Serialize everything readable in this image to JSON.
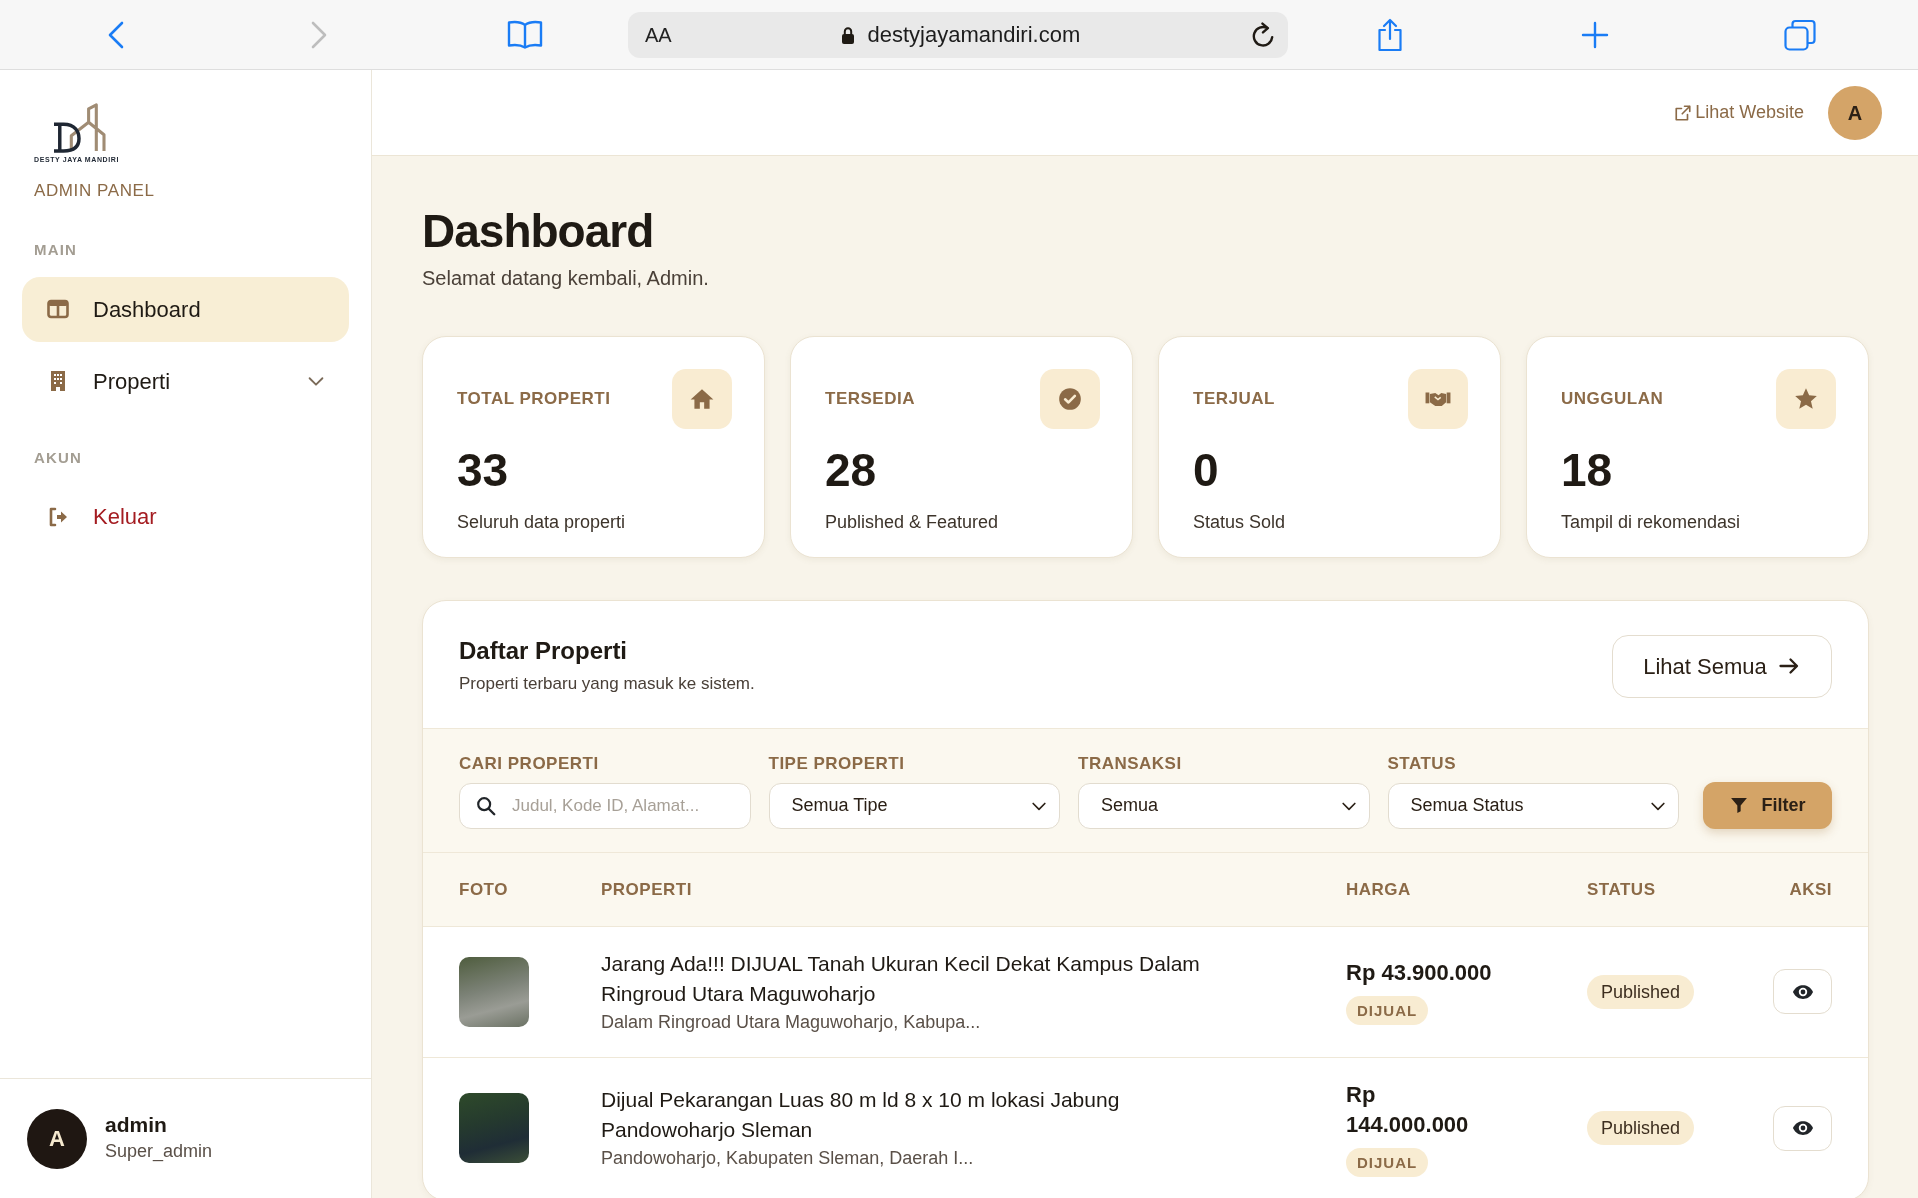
{
  "browser": {
    "nav_buttons": [
      {
        "kind": "back",
        "disabled": false
      },
      {
        "kind": "forward",
        "disabled": true
      }
    ],
    "text_size_button": "AA",
    "url": "destyjayamandiri.com"
  },
  "sidebar": {
    "logo_text": "DESTY JAYA MANDIRI",
    "title": "ADMIN PANEL",
    "sections": [
      {
        "heading": "MAIN",
        "items": [
          {
            "kind": "link",
            "label": "Dashboard",
            "selected": true
          },
          {
            "kind": "menu",
            "label": "Properti",
            "selected": false,
            "expanded": false
          }
        ]
      },
      {
        "heading": "AKUN",
        "items": [
          {
            "kind": "logout",
            "label": "Keluar",
            "selected": false
          }
        ]
      }
    ],
    "user": {
      "initial": "A",
      "name": "admin",
      "role": "Super_admin"
    }
  },
  "header": {
    "website_link": "Lihat Website",
    "avatar_initial": "A"
  },
  "page": {
    "title": "Dashboard",
    "subtitle": "Selamat datang kembali, Admin."
  },
  "stats": [
    {
      "kind": "total",
      "label": "TOTAL PROPERTI",
      "value": "33",
      "caption": "Seluruh data properti"
    },
    {
      "kind": "available",
      "label": "TERSEDIA",
      "value": "28",
      "caption": "Published & Featured"
    },
    {
      "kind": "sold",
      "label": "TERJUAL",
      "value": "0",
      "caption": "Status Sold"
    },
    {
      "kind": "featured",
      "label": "UNGGULAN",
      "value": "18",
      "caption": "Tampil di rekomendasi"
    }
  ],
  "property_list": {
    "title": "Daftar Properti",
    "subtitle": "Properti terbaru yang masuk ke sistem.",
    "view_all_button": "Lihat Semua",
    "filters": [
      {
        "kind": "search",
        "label": "CARI PROPERTI",
        "placeholder": "Judul, Kode ID, Alamat..."
      },
      {
        "kind": "select",
        "label": "TIPE PROPERTI",
        "value": "Semua Tipe"
      },
      {
        "kind": "select",
        "label": "TRANSAKSI",
        "value": "Semua"
      },
      {
        "kind": "select",
        "label": "STATUS",
        "value": "Semua Status"
      }
    ],
    "filter_button": "Filter",
    "table": {
      "columns": [
        "FOTO",
        "PROPERTI",
        "HARGA",
        "STATUS",
        "AKSI"
      ],
      "rows": [
        {
          "title": "Jarang Ada!!! DIJUAL Tanah Ukuran Kecil Dekat Kampus Dalam Ringroud Utara Maguwoharjo",
          "address": "Dalam Ringroad Utara Maguwoharjo, Kabupa...",
          "price": "Rp 43.900.000",
          "transaction": "DIJUAL",
          "status": "Published"
        },
        {
          "title": "Dijual Pekarangan Luas 80 m ld 8 x 10 m lokasi Jabung Pandowoharjo Sleman",
          "address": "Pandowoharjo, Kabupaten Sleman, Daerah I...",
          "price": "Rp 144.000.000",
          "transaction": "DIJUAL",
          "status": "Published"
        }
      ]
    }
  }
}
